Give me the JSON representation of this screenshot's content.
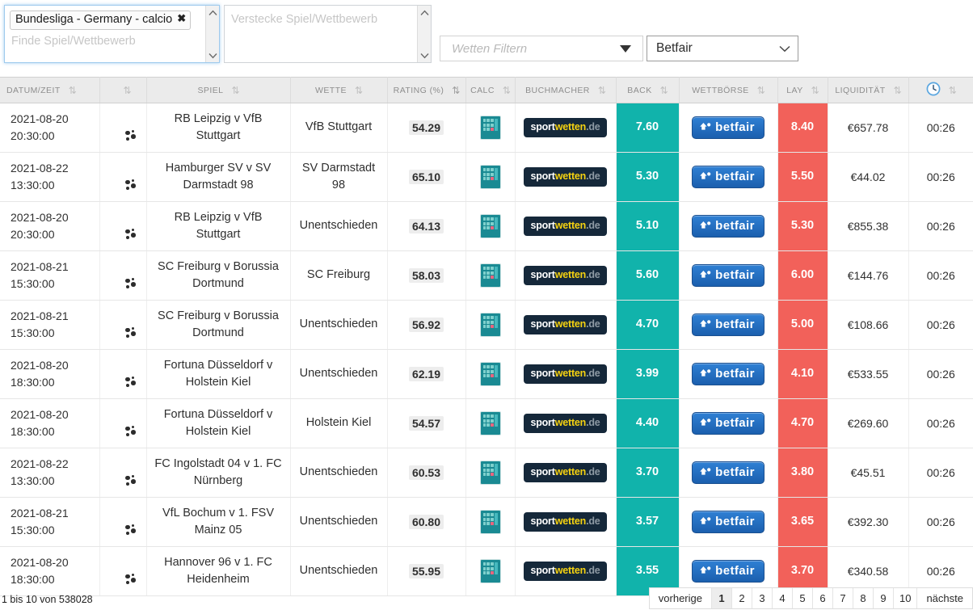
{
  "filters": {
    "selected_tag": "Bundesliga - Germany - calcio",
    "tag_remove_icon": "close-icon",
    "find_placeholder": "Finde Spiel/Wettbewerb",
    "hide_placeholder": "Verstecke Spiel/Wettbewerb",
    "bets_filter_placeholder": "Wetten Filtern",
    "exchange_value": "Betfair"
  },
  "table": {
    "columns": [
      {
        "label": "Datum/Zeit",
        "sort": "sort-icon"
      },
      {
        "label": "",
        "sort": "sort-icon"
      },
      {
        "label": "Spiel",
        "sort": "sort-icon"
      },
      {
        "label": "Wette",
        "sort": "sort-icon"
      },
      {
        "label": "Rating (%)",
        "sort": "sort-icon-active"
      },
      {
        "label": "Calc",
        "sort": "sort-icon"
      },
      {
        "label": "Buchmacher",
        "sort": "sort-icon"
      },
      {
        "label": "Back",
        "sort": "sort-icon"
      },
      {
        "label": "Wettbörse",
        "sort": "sort-icon"
      },
      {
        "label": "Lay",
        "sort": "sort-icon"
      },
      {
        "label": "Liquidität",
        "sort": "sort-icon"
      },
      {
        "label": "clock-icon",
        "sort": "sort-icon"
      }
    ],
    "rows": [
      {
        "date": "2021-08-20",
        "time": "20:30:00",
        "sport_icon": "football-icon",
        "match": "RB Leipzig v VfB Stuttgart",
        "bet": "VfB Stuttgart",
        "rating": "54.29",
        "calc_icon": "calculator-icon",
        "bookmaker": "sportwetten.de",
        "back": "7.60",
        "exchange": "betfair",
        "lay": "8.40",
        "liquidity": "€657.78",
        "age": "00:26"
      },
      {
        "date": "2021-08-22",
        "time": "13:30:00",
        "sport_icon": "football-icon",
        "match": "Hamburger SV v SV Darmstadt 98",
        "bet": "SV Darmstadt 98",
        "rating": "65.10",
        "calc_icon": "calculator-icon",
        "bookmaker": "sportwetten.de",
        "back": "5.30",
        "exchange": "betfair",
        "lay": "5.50",
        "liquidity": "€44.02",
        "age": "00:26"
      },
      {
        "date": "2021-08-20",
        "time": "20:30:00",
        "sport_icon": "football-icon",
        "match": "RB Leipzig v VfB Stuttgart",
        "bet": "Unentschieden",
        "rating": "64.13",
        "calc_icon": "calculator-icon",
        "bookmaker": "sportwetten.de",
        "back": "5.10",
        "exchange": "betfair",
        "lay": "5.30",
        "liquidity": "€855.38",
        "age": "00:26"
      },
      {
        "date": "2021-08-21",
        "time": "15:30:00",
        "sport_icon": "football-icon",
        "match": "SC Freiburg v Borussia Dortmund",
        "bet": "SC Freiburg",
        "rating": "58.03",
        "calc_icon": "calculator-icon",
        "bookmaker": "sportwetten.de",
        "back": "5.60",
        "exchange": "betfair",
        "lay": "6.00",
        "liquidity": "€144.76",
        "age": "00:26"
      },
      {
        "date": "2021-08-21",
        "time": "15:30:00",
        "sport_icon": "football-icon",
        "match": "SC Freiburg v Borussia Dortmund",
        "bet": "Unentschieden",
        "rating": "56.92",
        "calc_icon": "calculator-icon",
        "bookmaker": "sportwetten.de",
        "back": "4.70",
        "exchange": "betfair",
        "lay": "5.00",
        "liquidity": "€108.66",
        "age": "00:26"
      },
      {
        "date": "2021-08-20",
        "time": "18:30:00",
        "sport_icon": "football-icon",
        "match": "Fortuna Düsseldorf v Holstein Kiel",
        "bet": "Unentschieden",
        "rating": "62.19",
        "calc_icon": "calculator-icon",
        "bookmaker": "sportwetten.de",
        "back": "3.99",
        "exchange": "betfair",
        "lay": "4.10",
        "liquidity": "€533.55",
        "age": "00:26"
      },
      {
        "date": "2021-08-20",
        "time": "18:30:00",
        "sport_icon": "football-icon",
        "match": "Fortuna Düsseldorf v Holstein Kiel",
        "bet": "Holstein Kiel",
        "rating": "54.57",
        "calc_icon": "calculator-icon",
        "bookmaker": "sportwetten.de",
        "back": "4.40",
        "exchange": "betfair",
        "lay": "4.70",
        "liquidity": "€269.60",
        "age": "00:26"
      },
      {
        "date": "2021-08-22",
        "time": "13:30:00",
        "sport_icon": "football-icon",
        "match": "FC Ingolstadt 04 v 1. FC Nürnberg",
        "bet": "Unentschieden",
        "rating": "60.53",
        "calc_icon": "calculator-icon",
        "bookmaker": "sportwetten.de",
        "back": "3.70",
        "exchange": "betfair",
        "lay": "3.80",
        "liquidity": "€45.51",
        "age": "00:26"
      },
      {
        "date": "2021-08-21",
        "time": "15:30:00",
        "sport_icon": "football-icon",
        "match": "VfL Bochum v 1. FSV Mainz 05",
        "bet": "Unentschieden",
        "rating": "60.80",
        "calc_icon": "calculator-icon",
        "bookmaker": "sportwetten.de",
        "back": "3.57",
        "exchange": "betfair",
        "lay": "3.65",
        "liquidity": "€392.30",
        "age": "00:26"
      },
      {
        "date": "2021-08-20",
        "time": "18:30:00",
        "sport_icon": "football-icon",
        "match": "Hannover 96 v 1. FC Heidenheim",
        "bet": "Unentschieden",
        "rating": "55.95",
        "calc_icon": "calculator-icon",
        "bookmaker": "sportwetten.de",
        "back": "3.55",
        "exchange": "betfair",
        "lay": "3.70",
        "liquidity": "€340.58",
        "age": "00:26"
      }
    ]
  },
  "footer": {
    "count_text": "1 bis 10 von 538028",
    "prev_label": "vorherige",
    "next_label": "nächste",
    "pages": [
      "1",
      "2",
      "3",
      "4",
      "5",
      "6",
      "7",
      "8",
      "9",
      "10"
    ],
    "active_page": "1"
  },
  "colors": {
    "back": "#11b3ab",
    "lay": "#f2615a",
    "header_bg": "#ebebeb",
    "betfair_blue": "#2f80d4",
    "sportwetten_navy": "#15283a",
    "sportwetten_yellow": "#f5d211"
  }
}
